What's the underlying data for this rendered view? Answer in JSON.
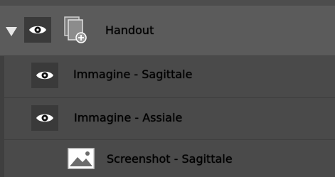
{
  "layers": {
    "group": {
      "label": "Handout",
      "expanded": true,
      "visible": true,
      "icon": "document-group-icon"
    },
    "children": [
      {
        "label": "Immagine - Sagittale",
        "visible": true,
        "icon": "eye-icon"
      },
      {
        "label": "Immagine - Assiale",
        "visible": true,
        "icon": "eye-icon"
      },
      {
        "label": "Screenshot - Sagittale",
        "icon": "image-icon"
      }
    ]
  },
  "colors": {
    "panel_bg": "#4d4d4d",
    "group_bg": "#5b5b5b",
    "text": "#ffffff"
  }
}
